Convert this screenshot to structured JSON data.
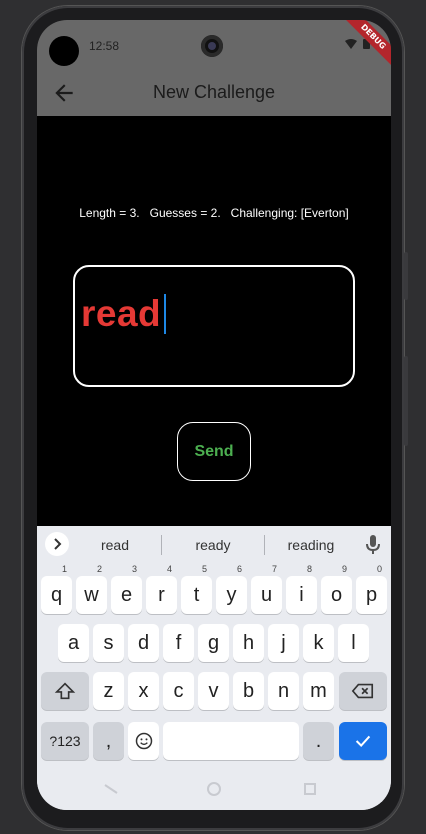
{
  "status": {
    "time": "12:58"
  },
  "debug_banner": "DEBUG",
  "app_bar": {
    "title": "New Challenge",
    "back_icon": "arrow-back-icon"
  },
  "info": {
    "text": "Length = 3.   Guesses = 2.   Challenging: [Everton]"
  },
  "guess": {
    "value": "read"
  },
  "send": {
    "label": "Send"
  },
  "keyboard": {
    "suggestions": [
      "read",
      "ready",
      "reading"
    ],
    "row1": [
      {
        "k": "q",
        "h": "1"
      },
      {
        "k": "w",
        "h": "2"
      },
      {
        "k": "e",
        "h": "3"
      },
      {
        "k": "r",
        "h": "4"
      },
      {
        "k": "t",
        "h": "5"
      },
      {
        "k": "y",
        "h": "6"
      },
      {
        "k": "u",
        "h": "7"
      },
      {
        "k": "i",
        "h": "8"
      },
      {
        "k": "o",
        "h": "9"
      },
      {
        "k": "p",
        "h": "0"
      }
    ],
    "row2": [
      "a",
      "s",
      "d",
      "f",
      "g",
      "h",
      "j",
      "k",
      "l"
    ],
    "row3": [
      "z",
      "x",
      "c",
      "v",
      "b",
      "n",
      "m"
    ],
    "symbols_label": "?123",
    "comma_label": ",",
    "period_label": ".",
    "shift_icon": "shift-icon",
    "backspace_icon": "backspace-icon",
    "emoji_icon": "emoji-icon",
    "enter_icon": "checkmark-icon",
    "accent_color": "#1a73e8"
  },
  "colors": {
    "guess_text": "#e53935",
    "send_text": "#4caf50",
    "app_bar": "#686868"
  }
}
